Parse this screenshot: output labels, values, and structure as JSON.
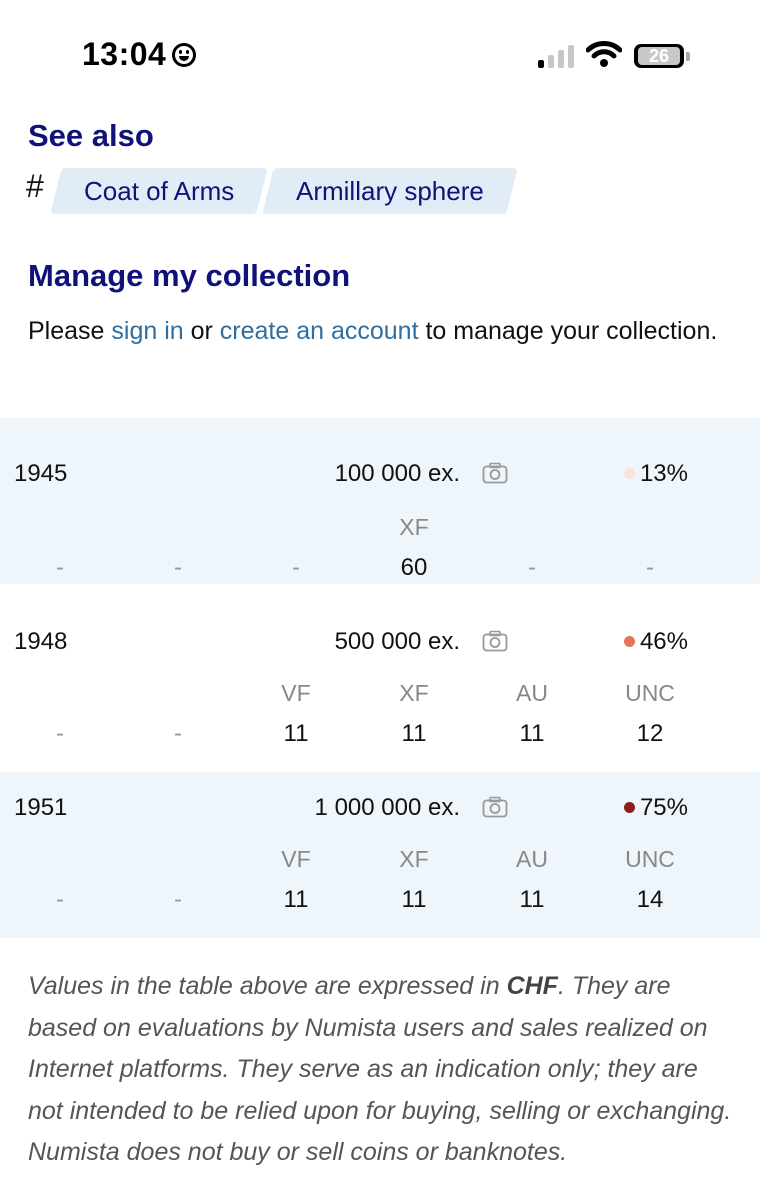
{
  "status_bar": {
    "time": "13:04",
    "battery": "26"
  },
  "see_also": {
    "title": "See also",
    "hash": "#",
    "tags": [
      "Coat of Arms",
      "Armillary sphere"
    ]
  },
  "manage": {
    "title": "Manage my collection",
    "text_before": "Please ",
    "sign_in": "sign in",
    "text_mid": " or ",
    "create_account": "create an account",
    "text_after": " to manage your collection."
  },
  "mintage_rows": [
    {
      "year": "1945",
      "mintage": "100 000 ex.",
      "percent": "13%",
      "dot_color": "#f7e3da",
      "grades": [
        "",
        "",
        "",
        "XF",
        "",
        ""
      ],
      "values": [
        "-",
        "-",
        "-",
        "60",
        "-",
        "-"
      ]
    },
    {
      "year": "1948",
      "mintage": "500 000 ex.",
      "percent": "46%",
      "dot_color": "#e2745a",
      "grades": [
        "",
        "",
        "VF",
        "XF",
        "AU",
        "UNC"
      ],
      "values": [
        "-",
        "-",
        "11",
        "11",
        "11",
        "12"
      ]
    },
    {
      "year": "1951",
      "mintage": "1 000 000 ex.",
      "percent": "75%",
      "dot_color": "#8e1d1d",
      "grades": [
        "",
        "",
        "VF",
        "XF",
        "AU",
        "UNC"
      ],
      "values": [
        "-",
        "-",
        "11",
        "11",
        "11",
        "14"
      ]
    }
  ],
  "note": {
    "before": "Values in the table above are expressed in ",
    "currency": "CHF",
    "after": ". They are based on evaluations by Numista users and sales realized on Internet platforms. They serve as an indication only; they are not intended to be relied upon for buying, selling or exchanging. Numista does not buy or sell coins or banknotes."
  },
  "colors": {
    "heading": "#10127a",
    "link": "#2f6ea0",
    "tag_bg": "#e2ecf6",
    "row_shade": "#eef5fb"
  }
}
